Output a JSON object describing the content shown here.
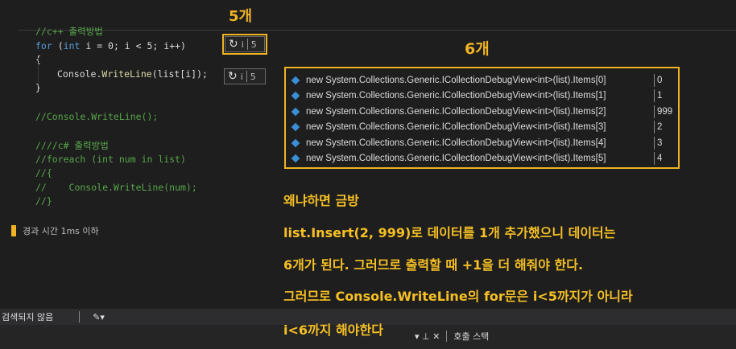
{
  "code": {
    "line1": "//c++ 출력방법",
    "line2_kw": "for",
    "line2_a": " (",
    "line2_int": "int",
    "line2_b": " i = 0; i < 5; i++)",
    "line3": "{",
    "line4_a": "Console.",
    "line4_fn": "WriteLine",
    "line4_b": "(list[i]);",
    "line5": "}",
    "line6": "//Console.WriteLine();",
    "line7": "////c# 출력방법",
    "line8": "//foreach (int num in list)",
    "line9": "//{",
    "line10": "//    Console.WriteLine(num);",
    "line11": "//}"
  },
  "chips": {
    "chip1_text": "i",
    "chip1_value": "5",
    "chip2_text": "i",
    "chip2_value": "5"
  },
  "annotations": {
    "five": "5개",
    "six": "6개"
  },
  "debug_view": {
    "rows": [
      {
        "name": "new System.Collections.Generic.ICollectionDebugView<int>(list).Items[0]",
        "value": "0"
      },
      {
        "name": "new System.Collections.Generic.ICollectionDebugView<int>(list).Items[1]",
        "value": "1"
      },
      {
        "name": "new System.Collections.Generic.ICollectionDebugView<int>(list).Items[2]",
        "value": "999"
      },
      {
        "name": "new System.Collections.Generic.ICollectionDebugView<int>(list).Items[3]",
        "value": "2"
      },
      {
        "name": "new System.Collections.Generic.ICollectionDebugView<int>(list).Items[4]",
        "value": "3"
      },
      {
        "name": "new System.Collections.Generic.ICollectionDebugView<int>(list).Items[5]",
        "value": "4"
      }
    ]
  },
  "explanation": {
    "line1": "왜냐하면 금방",
    "line2": "list.Insert(2, 999)로 데이터를 1개 추가했으니 데이터는",
    "line3": "6개가 된다. 그러므로 출력할 때 +1을 더 해줘야 한다.",
    "line4": "그러므로 Console.WriteLine의 for문은 i<5까지가 아니라",
    "line5": "i<6까지 해야한다"
  },
  "status": {
    "elapsed": "경과 시간 1ms 이하"
  },
  "bottom": {
    "search_text": "검색되지 않음",
    "pin_icons": "▾ ⊥ ✕",
    "call_stack_tab": "호출 스택"
  },
  "colors": {
    "accent": "#f0b323",
    "keyword": "#569cd6",
    "comment": "#57a64a"
  }
}
